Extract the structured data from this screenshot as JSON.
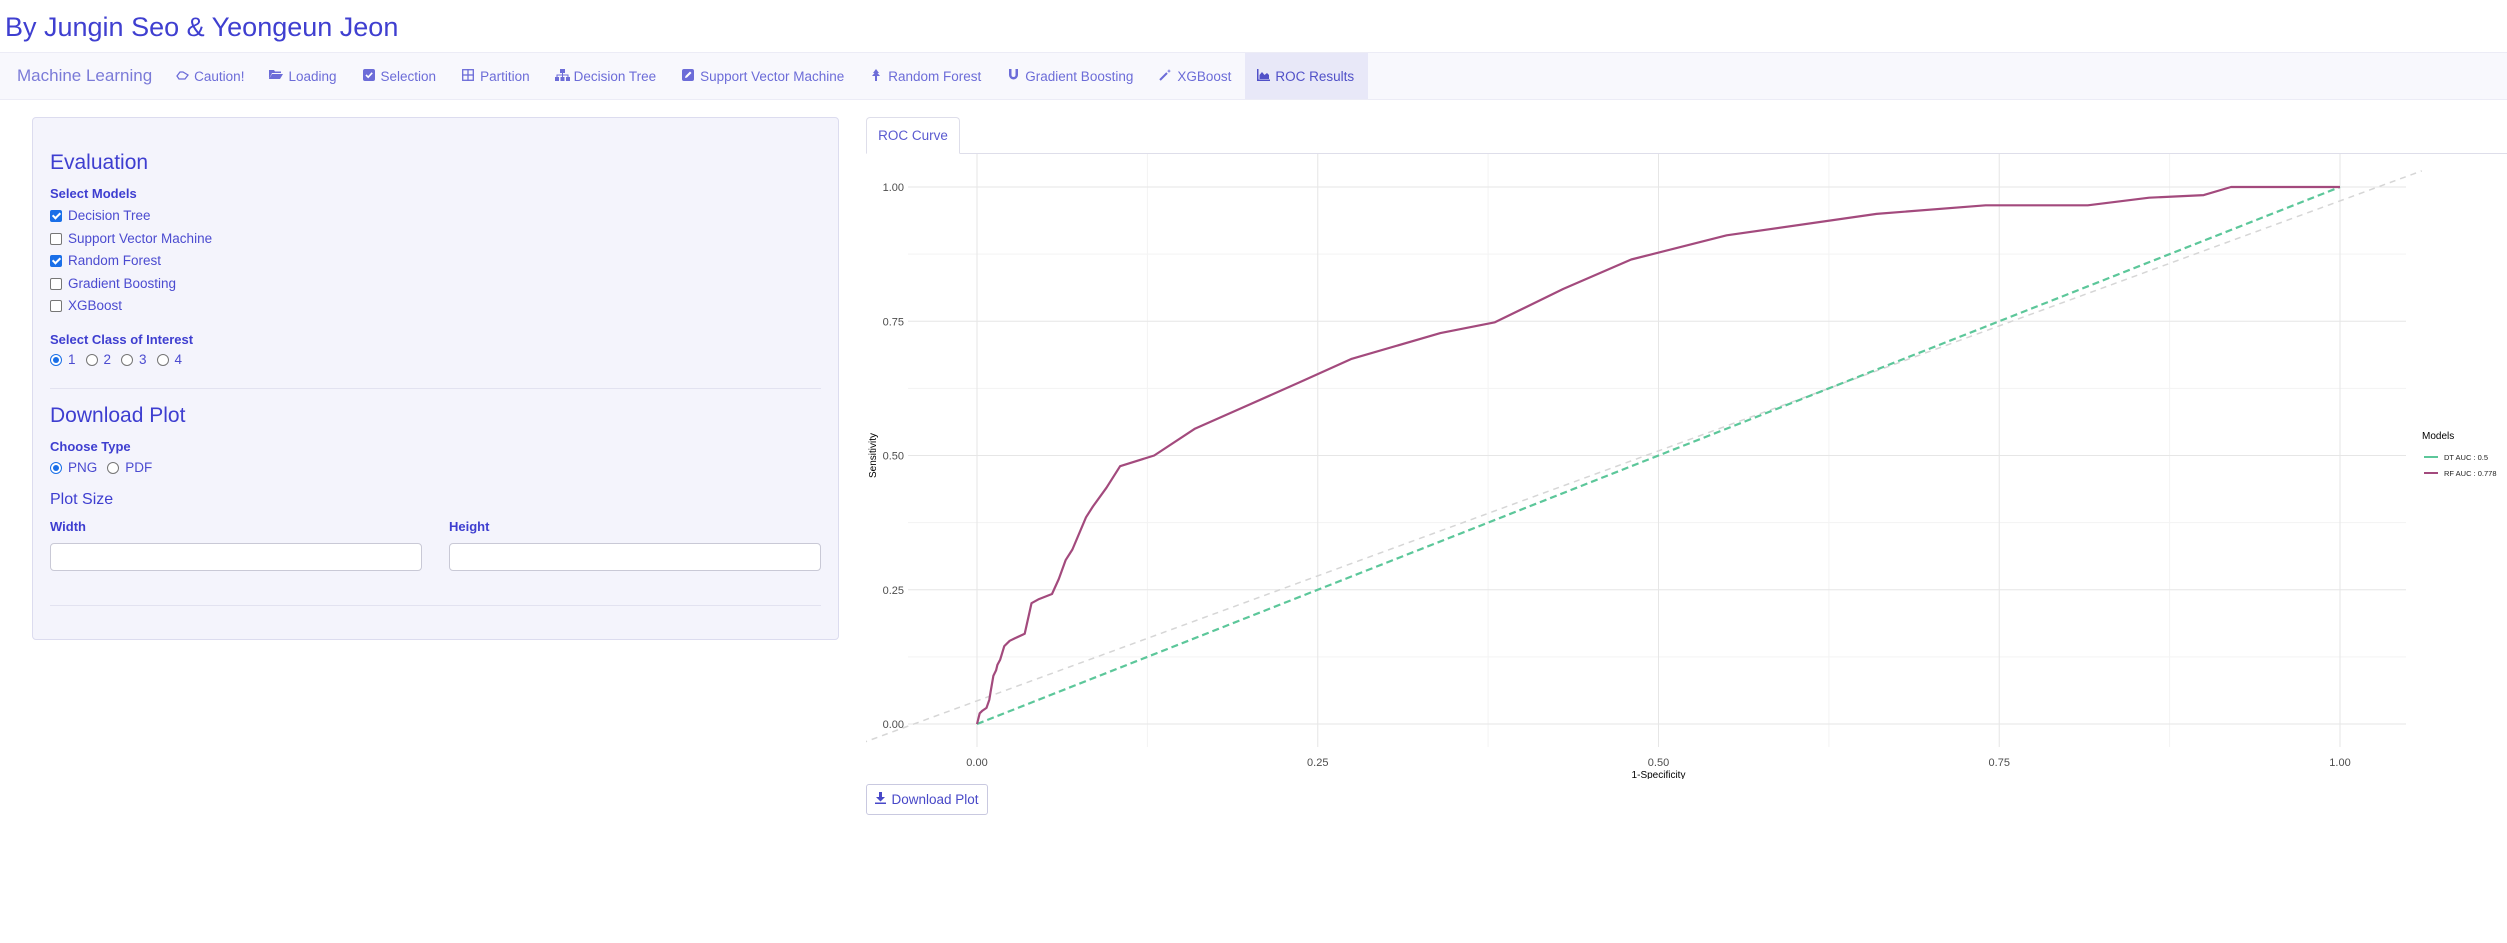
{
  "app": {
    "title": "By Jungin Seo & Yeongeun Jeon"
  },
  "navbar": {
    "brand": "Machine Learning",
    "items": [
      {
        "label": "Caution!",
        "icon": "hand-icon",
        "active": false
      },
      {
        "label": "Loading",
        "icon": "folder-open-icon",
        "active": false
      },
      {
        "label": "Selection",
        "icon": "check-square-icon",
        "active": false
      },
      {
        "label": "Partition",
        "icon": "grid-icon",
        "active": false
      },
      {
        "label": "Decision Tree",
        "icon": "sitemap-icon",
        "active": false
      },
      {
        "label": "Support Vector Machine",
        "icon": "edit-square-icon",
        "active": false
      },
      {
        "label": "Random Forest",
        "icon": "tree-icon",
        "active": false
      },
      {
        "label": "Gradient Boosting",
        "icon": "magnet-icon",
        "active": false
      },
      {
        "label": "XGBoost",
        "icon": "wand-icon",
        "active": false
      },
      {
        "label": "ROC Results",
        "icon": "chart-area-icon",
        "active": true
      }
    ]
  },
  "sidebar": {
    "evaluation_title": "Evaluation",
    "select_models_label": "Select Models",
    "models": [
      {
        "label": "Decision Tree",
        "checked": true
      },
      {
        "label": "Support Vector Machine",
        "checked": false
      },
      {
        "label": "Random Forest",
        "checked": true
      },
      {
        "label": "Gradient Boosting",
        "checked": false
      },
      {
        "label": "XGBoost",
        "checked": false
      }
    ],
    "class_label": "Select Class of Interest",
    "classes": [
      {
        "label": "1",
        "checked": true
      },
      {
        "label": "2",
        "checked": false
      },
      {
        "label": "3",
        "checked": false
      },
      {
        "label": "4",
        "checked": false
      }
    ],
    "download_title": "Download Plot",
    "choose_type_label": "Choose Type",
    "types": [
      {
        "label": "PNG",
        "checked": true
      },
      {
        "label": "PDF",
        "checked": false
      }
    ],
    "plot_size_title": "Plot Size",
    "width_label": "Width",
    "height_label": "Height",
    "width_value": "",
    "height_value": ""
  },
  "tabs": [
    {
      "label": "ROC Curve",
      "active": true
    }
  ],
  "download_button": {
    "label": "Download Plot",
    "icon": "download-icon"
  },
  "chart_data": {
    "type": "line",
    "title": "",
    "xlabel": "1-Specificity",
    "ylabel": "Sensitivity",
    "xlim": [
      0,
      1
    ],
    "ylim": [
      0,
      1
    ],
    "x_ticks": [
      "0.00",
      "0.25",
      "0.50",
      "0.75",
      "1.00"
    ],
    "y_ticks": [
      "0.00",
      "0.25",
      "0.50",
      "0.75",
      "1.00"
    ],
    "grid": true,
    "legend_title": "Models",
    "legend_position": "right",
    "reference_line": {
      "style": "dashed",
      "color": "#d6d6d6",
      "from": [
        0,
        0
      ],
      "to": [
        1,
        1
      ]
    },
    "series": [
      {
        "name": "DT AUC : 0.5",
        "color": "#5cc79a",
        "dashed": true,
        "x": [
          0,
          1
        ],
        "y": [
          0,
          1
        ]
      },
      {
        "name": "RF AUC : 0.778",
        "color": "#a34a7d",
        "dashed": false,
        "x": [
          0.0,
          0.002,
          0.004,
          0.007,
          0.009,
          0.01,
          0.012,
          0.014,
          0.015,
          0.017,
          0.02,
          0.024,
          0.028,
          0.035,
          0.04,
          0.045,
          0.055,
          0.06,
          0.065,
          0.07,
          0.08,
          0.085,
          0.095,
          0.105,
          0.13,
          0.16,
          0.2,
          0.24,
          0.275,
          0.34,
          0.38,
          0.43,
          0.48,
          0.55,
          0.66,
          0.74,
          0.815,
          0.86,
          0.9,
          0.92,
          1.0
        ],
        "y": [
          0.0,
          0.02,
          0.025,
          0.03,
          0.045,
          0.06,
          0.09,
          0.1,
          0.11,
          0.12,
          0.145,
          0.155,
          0.16,
          0.168,
          0.225,
          0.232,
          0.242,
          0.27,
          0.305,
          0.325,
          0.385,
          0.405,
          0.44,
          0.48,
          0.5,
          0.55,
          0.595,
          0.64,
          0.68,
          0.728,
          0.748,
          0.81,
          0.865,
          0.91,
          0.95,
          0.966,
          0.966,
          0.98,
          0.985,
          1.0,
          1.0
        ]
      }
    ]
  }
}
